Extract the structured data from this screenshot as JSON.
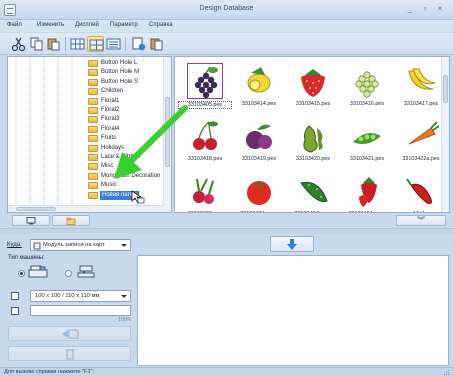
{
  "window": {
    "title": "Design Database"
  },
  "menu": [
    "Файл",
    "Изменить",
    "Дисплей",
    "Параметр",
    "Справка"
  ],
  "tree": {
    "items": [
      {
        "label": "Button Hole L",
        "selected": false
      },
      {
        "label": "Button Hole M",
        "selected": false
      },
      {
        "label": "Button Hole S",
        "selected": false
      },
      {
        "label": "Children",
        "selected": false
      },
      {
        "label": "Floral1",
        "selected": false
      },
      {
        "label": "Floral2",
        "selected": false
      },
      {
        "label": "Floral3",
        "selected": false
      },
      {
        "label": "Floral4",
        "selected": false
      },
      {
        "label": "Fruits",
        "selected": false
      },
      {
        "label": "Holidays",
        "selected": false
      },
      {
        "label": "Lace & Ribbon",
        "selected": false
      },
      {
        "label": "Misc",
        "selected": false
      },
      {
        "label": "Monogram Decoration",
        "selected": false
      },
      {
        "label": "Music",
        "selected": false
      },
      {
        "label": "Новая папка",
        "selected": true
      }
    ]
  },
  "thumbnails": [
    {
      "label": "33103405.pes",
      "icon": "grapes-icon",
      "selected": true
    },
    {
      "label": "33103414.pes",
      "icon": "lemon-icon",
      "selected": false
    },
    {
      "label": "33103415.pes",
      "icon": "strawberry-icon",
      "selected": false
    },
    {
      "label": "33103416.pes",
      "icon": "green-grapes-icon",
      "selected": false
    },
    {
      "label": "33103417.pes",
      "icon": "bananas-icon",
      "selected": false
    },
    {
      "label": "33103418.pes",
      "icon": "cherries-icon",
      "selected": false
    },
    {
      "label": "33103419.pes",
      "icon": "plums-icon",
      "selected": false
    },
    {
      "label": "33103420.pes",
      "icon": "pears-icon",
      "selected": false
    },
    {
      "label": "33103421.pes",
      "icon": "peas-icon",
      "selected": false
    },
    {
      "label": "33103422a.pes",
      "icon": "carrot-icon",
      "selected": false
    },
    {
      "label": "33103423.pes",
      "icon": "radishes-icon",
      "selected": false
    },
    {
      "label": "33103424a.pes",
      "icon": "tomato-icon",
      "selected": false
    },
    {
      "label": "33103424b.pes",
      "icon": "cucumber-icon",
      "selected": false
    },
    {
      "label": "33103424c.pes",
      "icon": "strawberries-icon",
      "selected": false
    },
    {
      "label": "no14_1.pes",
      "icon": "chili-icon",
      "selected": false
    }
  ],
  "lower": {
    "where_label": "Куда:",
    "destination_value": "Модуль записи на карт",
    "machine_type_label": "Тип машины:",
    "machine_option_selected": 0,
    "hoop_size_value": "100 x 100 / 110 x 110 мм",
    "progress_percent": "100%",
    "progress_value": 0
  },
  "status": {
    "text": "Для вызова справки нажмите \"F1\"."
  },
  "colors": {
    "accent": "#3c7fd8",
    "arrow": "#36d02f",
    "send_arrow": "#2f7fe0"
  }
}
